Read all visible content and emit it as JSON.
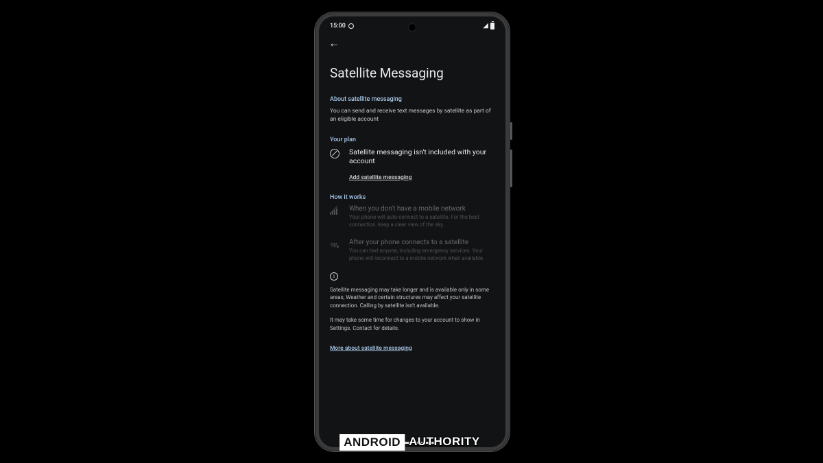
{
  "status_bar": {
    "time": "15:00"
  },
  "page": {
    "title": "Satellite Messaging"
  },
  "about": {
    "header": "About satellite messaging",
    "body": "You can send and receive text messages by satellite as part of an eligible  account"
  },
  "plan": {
    "header": "Your  plan",
    "title": "Satellite messaging isn't included with your account",
    "link": "Add satellite messaging"
  },
  "how": {
    "header": "How it works",
    "items": [
      {
        "title": "When you don't have a mobile network",
        "desc": "Your phone will auto-connect to a satellite. For the best connection, keep a clear view of the sky."
      },
      {
        "title": "After your phone connects to a satellite",
        "desc": "You can text anyone, including emergency services. Your phone will reconnect to a mobile network when available."
      }
    ]
  },
  "disclaimer": {
    "p1": "Satellite messaging may take longer and is available only in some areas, Weather and certain structures may affect your satellite connection. Calling by satellite isn't available.",
    "p2": "It may take some time for changes to your account to show in Settings. Contact  for details.",
    "link": "More about satellite messaging"
  },
  "watermark": {
    "left": "ANDROID",
    "right": "AUTHORITY"
  }
}
